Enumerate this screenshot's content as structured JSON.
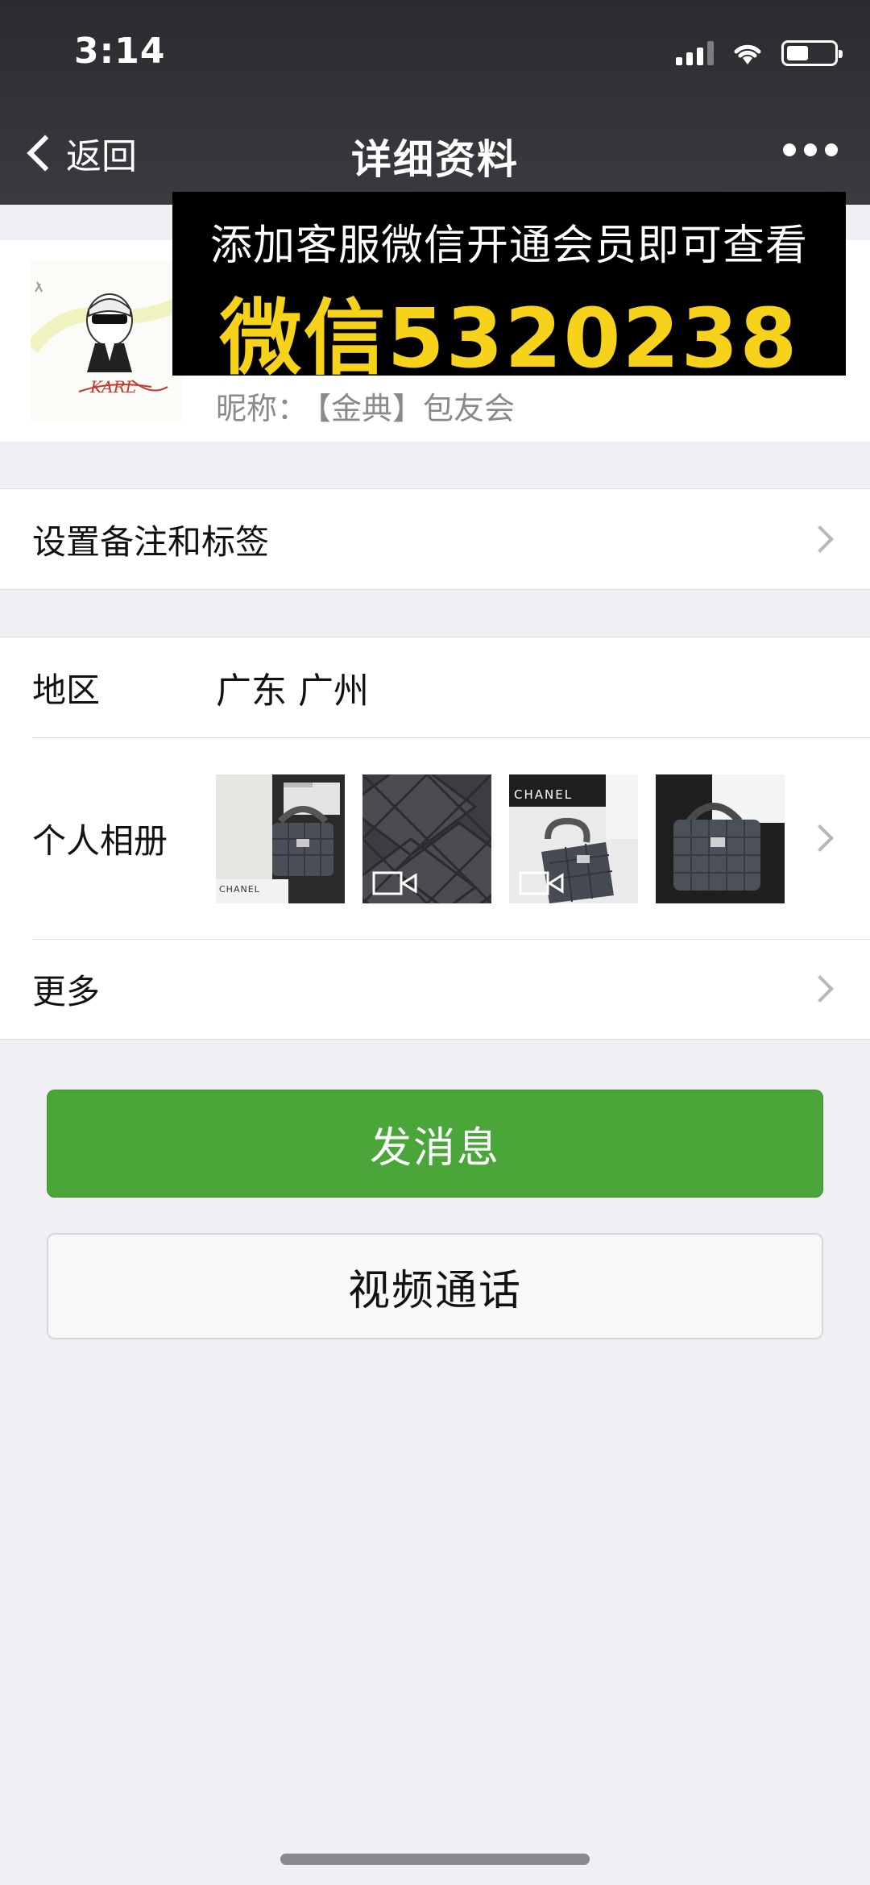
{
  "status_bar": {
    "time": "3:14"
  },
  "nav": {
    "back_label": "返回",
    "title": "详细资料"
  },
  "profile": {
    "nickname_label": "昵称：",
    "nickname_value": "【金典】包友会",
    "avatar_caption": "KARL"
  },
  "ad": {
    "line1": "添加客服微信开通会员即可查看",
    "line2": "微信5320238"
  },
  "rows": {
    "remark_label": "设置备注和标签",
    "region_label": "地区",
    "region_value": "广东 广州",
    "album_label": "个人相册",
    "more_label": "更多"
  },
  "buttons": {
    "message": "发消息",
    "video_call": "视频通话"
  },
  "album_items": [
    {
      "type": "photo",
      "brand_text": "CHANEL"
    },
    {
      "type": "video"
    },
    {
      "type": "video",
      "brand_text": "CHANEL"
    },
    {
      "type": "photo"
    }
  ],
  "colors": {
    "nav_bg": "#2f3034",
    "primary_green": "#4ba63a",
    "ad_yellow": "#f6d31a",
    "page_bg": "#efeff4"
  }
}
